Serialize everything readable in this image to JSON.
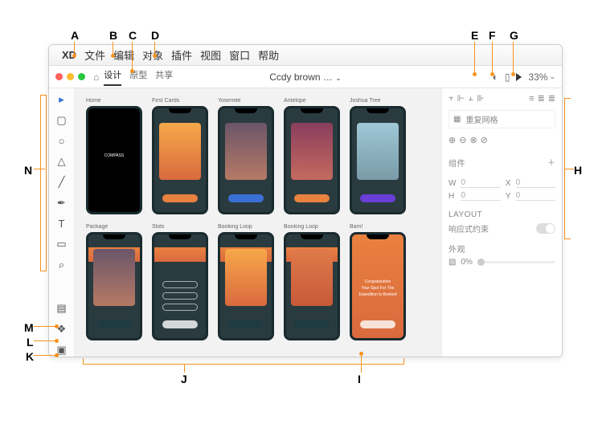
{
  "menubar": {
    "apple": "",
    "app": "XD",
    "items": [
      "文件",
      "编辑",
      "对象",
      "插件",
      "视图",
      "窗口",
      "帮助"
    ]
  },
  "titlebar": {
    "tabs": [
      "设计",
      "原型",
      "共享"
    ],
    "active_tab_index": 0,
    "title": "Ccdy brown …",
    "zoom": "33%"
  },
  "tools": {
    "select": "▸",
    "rect": "▢",
    "circle": "○",
    "triangle": "△",
    "line": "╱",
    "pen": "✒",
    "text": "T",
    "artboard": "▭",
    "zoom": "⌕",
    "assets": "▤",
    "layers": "❖",
    "plugins": "▣"
  },
  "artboards": [
    {
      "name": "Home",
      "variant": "dark",
      "btn": "",
      "center": "COMPASS"
    },
    {
      "name": "First Cards",
      "variant": "grad g-orange",
      "btn": "b-orange"
    },
    {
      "name": "Yosemite",
      "variant": "grad g-rock1",
      "btn": "b-blue"
    },
    {
      "name": "Antelope",
      "variant": "grad g-rock2",
      "btn": "b-orange"
    },
    {
      "name": "Joshua Tree",
      "variant": "grad g-sky",
      "btn": "b-purple"
    },
    {
      "name": "Package",
      "variant": "header-orange grad g-rock1",
      "btn": "b-dark"
    },
    {
      "name": "Slots",
      "variant": "header-orange pills",
      "btn": "b-white"
    },
    {
      "name": "Booking Loop",
      "variant": "header-orange grad g-orange",
      "btn": "b-dark"
    },
    {
      "name": "Booking Loop",
      "variant": "header-orange grad g-orange2",
      "btn": "b-dark"
    },
    {
      "name": "Bam!",
      "variant": "orangefull",
      "btn": "b-white",
      "center": "Congratulation\\nYour Spot For The\\nExpedition Is Booked"
    }
  ],
  "right_panel": {
    "align_icons": [
      "⫟",
      "⊩",
      "⫠",
      "⊪",
      "≡",
      "≣",
      "≣"
    ],
    "repeat_grid": "重复网格",
    "bool_ops": [
      "⊕",
      "⊖",
      "⊗",
      "⊘"
    ],
    "section_component": "组件",
    "W": "W",
    "W_val": "0",
    "X": "X",
    "X_val": "0",
    "H": "H",
    "H_val": "0",
    "Y": "Y",
    "Y_val": "0",
    "section_layout": "LAYOUT",
    "responsive": "响应式约束",
    "section_appearance": "外观",
    "opacity": "0%"
  },
  "callouts": {
    "A": "A",
    "B": "B",
    "C": "C",
    "D": "D",
    "E": "E",
    "F": "F",
    "G": "G",
    "H": "H",
    "I": "I",
    "J": "J",
    "K": "K",
    "L": "L",
    "M": "M",
    "N": "N"
  }
}
